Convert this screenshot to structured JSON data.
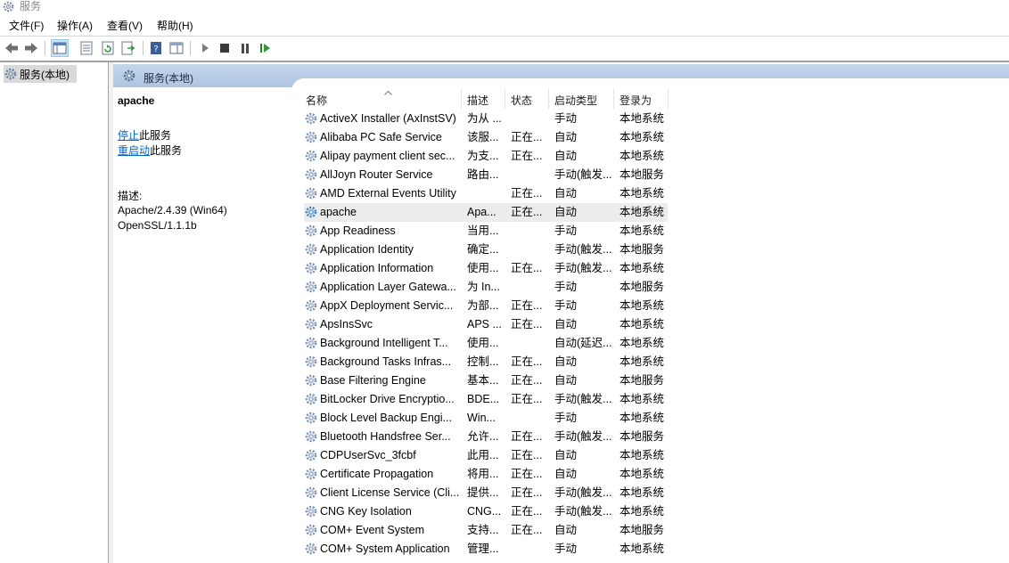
{
  "window": {
    "title": "服务"
  },
  "menu": [
    "文件(F)",
    "操作(A)",
    "查看(V)",
    "帮助(H)"
  ],
  "toolbar": {
    "buttons": [
      "back-arrow-icon",
      "forward-arrow-icon",
      "console-tree-icon",
      "properties-icon",
      "refresh-icon",
      "export-list-icon",
      "help-icon",
      "show-hide-icon",
      "start-icon",
      "stop-icon",
      "pause-icon",
      "restart-icon"
    ]
  },
  "tree": {
    "root_label": "服务(本地)"
  },
  "panel": {
    "header": "服务(本地)",
    "selected_service": "apache",
    "stop_link": "停止",
    "stop_suffix": "此服务",
    "restart_link": "重启动",
    "restart_suffix": "此服务",
    "desc_label": "描述:",
    "desc_line1": "Apache/2.4.39 (Win64)",
    "desc_line2": "OpenSSL/1.1.1b"
  },
  "columns": {
    "name": "名称",
    "desc": "描述",
    "status": "状态",
    "startup": "启动类型",
    "logon": "登录为"
  },
  "services": [
    {
      "name": "ActiveX Installer (AxInstSV)",
      "desc": "为从 ...",
      "status": "",
      "startup": "手动",
      "logon": "本地系统"
    },
    {
      "name": "Alibaba PC Safe Service",
      "desc": "该服...",
      "status": "正在...",
      "startup": "自动",
      "logon": "本地系统"
    },
    {
      "name": "Alipay payment client sec...",
      "desc": "为支...",
      "status": "正在...",
      "startup": "自动",
      "logon": "本地系统"
    },
    {
      "name": "AllJoyn Router Service",
      "desc": "路由...",
      "status": "",
      "startup": "手动(触发...",
      "logon": "本地服务"
    },
    {
      "name": "AMD External Events Utility",
      "desc": "",
      "status": "正在...",
      "startup": "自动",
      "logon": "本地系统"
    },
    {
      "name": "apache",
      "desc": "Apa...",
      "status": "正在...",
      "startup": "自动",
      "logon": "本地系统",
      "selected": true
    },
    {
      "name": "App Readiness",
      "desc": "当用...",
      "status": "",
      "startup": "手动",
      "logon": "本地系统"
    },
    {
      "name": "Application Identity",
      "desc": "确定...",
      "status": "",
      "startup": "手动(触发...",
      "logon": "本地服务"
    },
    {
      "name": "Application Information",
      "desc": "使用...",
      "status": "正在...",
      "startup": "手动(触发...",
      "logon": "本地系统"
    },
    {
      "name": "Application Layer Gatewa...",
      "desc": "为 In...",
      "status": "",
      "startup": "手动",
      "logon": "本地服务"
    },
    {
      "name": "AppX Deployment Servic...",
      "desc": "为部...",
      "status": "正在...",
      "startup": "手动",
      "logon": "本地系统"
    },
    {
      "name": "ApsInsSvc",
      "desc": "APS ...",
      "status": "正在...",
      "startup": "自动",
      "logon": "本地系统"
    },
    {
      "name": "Background Intelligent T...",
      "desc": "使用...",
      "status": "",
      "startup": "自动(延迟...",
      "logon": "本地系统"
    },
    {
      "name": "Background Tasks Infras...",
      "desc": "控制...",
      "status": "正在...",
      "startup": "自动",
      "logon": "本地系统"
    },
    {
      "name": "Base Filtering Engine",
      "desc": "基本...",
      "status": "正在...",
      "startup": "自动",
      "logon": "本地服务"
    },
    {
      "name": "BitLocker Drive Encryptio...",
      "desc": "BDE...",
      "status": "正在...",
      "startup": "手动(触发...",
      "logon": "本地系统"
    },
    {
      "name": "Block Level Backup Engi...",
      "desc": "Win...",
      "status": "",
      "startup": "手动",
      "logon": "本地系统"
    },
    {
      "name": "Bluetooth Handsfree Ser...",
      "desc": "允许...",
      "status": "正在...",
      "startup": "手动(触发...",
      "logon": "本地服务"
    },
    {
      "name": "CDPUserSvc_3fcbf",
      "desc": "此用...",
      "status": "正在...",
      "startup": "自动",
      "logon": "本地系统"
    },
    {
      "name": "Certificate Propagation",
      "desc": "将用...",
      "status": "正在...",
      "startup": "自动",
      "logon": "本地系统"
    },
    {
      "name": "Client License Service (Cli...",
      "desc": "提供...",
      "status": "正在...",
      "startup": "手动(触发...",
      "logon": "本地系统"
    },
    {
      "name": "CNG Key Isolation",
      "desc": "CNG...",
      "status": "正在...",
      "startup": "手动(触发...",
      "logon": "本地系统"
    },
    {
      "name": "COM+ Event System",
      "desc": "支持...",
      "status": "正在...",
      "startup": "自动",
      "logon": "本地服务"
    },
    {
      "name": "COM+ System Application",
      "desc": "管理...",
      "status": "",
      "startup": "手动",
      "logon": "本地系统"
    }
  ]
}
